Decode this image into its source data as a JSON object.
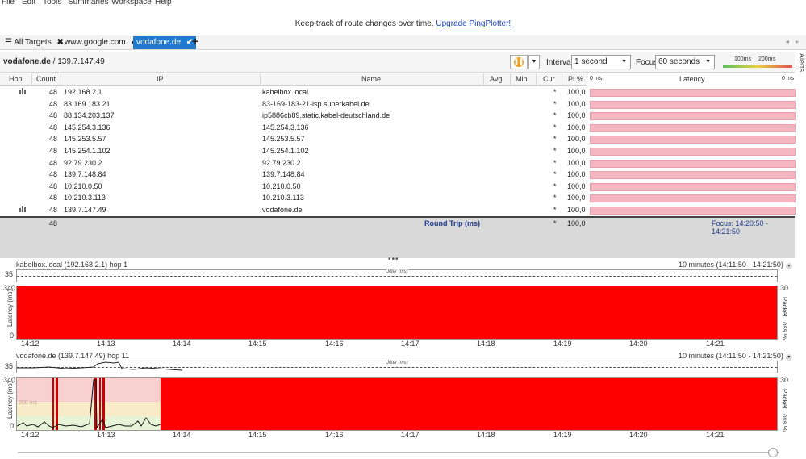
{
  "menu": [
    "File",
    "Edit",
    "Tools",
    "Summaries",
    "Workspace",
    "Help"
  ],
  "banner": {
    "text": "Keep track of route changes over time.",
    "link": "Upgrade PingPlotter!"
  },
  "tabs": [
    {
      "label": "All Targets",
      "marker": "✖"
    },
    {
      "label": "www.google.com",
      "marker": "✔"
    },
    {
      "label": "vodafone.de",
      "marker": "✔"
    }
  ],
  "tab_add": "+",
  "alerts_label": "Alerts",
  "toolbar": {
    "target_name": "vodafone.de",
    "target_ip": " / 139.7.147.49",
    "interval_label": "Interval",
    "interval_value": "1 second",
    "focus_label": "Focus",
    "focus_value": "60 seconds",
    "scale_low": "100ms",
    "scale_high": "200ms"
  },
  "table": {
    "columns": [
      "Hop",
      "Count",
      "IP",
      "Name",
      "Avg",
      "Min",
      "Cur",
      "PL%",
      "Latency"
    ],
    "latency_min": "0 ms",
    "latency_max": "0 ms",
    "rows": [
      {
        "hop_icon": true,
        "count": "48",
        "ip": "192.168.2.1",
        "name": "kabelbox.local",
        "avg": "",
        "min": "",
        "cur": "*",
        "pl": "100,0"
      },
      {
        "hop_icon": false,
        "count": "48",
        "ip": "83.169.183.21",
        "name": "83-169-183-21-isp.superkabel.de",
        "avg": "",
        "min": "",
        "cur": "*",
        "pl": "100,0"
      },
      {
        "hop_icon": false,
        "count": "48",
        "ip": "88.134.203.137",
        "name": "ip5886cb89.static.kabel-deutschland.de",
        "avg": "",
        "min": "",
        "cur": "*",
        "pl": "100,0"
      },
      {
        "hop_icon": false,
        "count": "48",
        "ip": "145.254.3.136",
        "name": "145.254.3.136",
        "avg": "",
        "min": "",
        "cur": "*",
        "pl": "100,0"
      },
      {
        "hop_icon": false,
        "count": "48",
        "ip": "145.253.5.57",
        "name": "145.253.5.57",
        "avg": "",
        "min": "",
        "cur": "*",
        "pl": "100,0"
      },
      {
        "hop_icon": false,
        "count": "48",
        "ip": "145.254.1.102",
        "name": "145.254.1.102",
        "avg": "",
        "min": "",
        "cur": "*",
        "pl": "100,0"
      },
      {
        "hop_icon": false,
        "count": "48",
        "ip": "92.79.230.2",
        "name": "92.79.230.2",
        "avg": "",
        "min": "",
        "cur": "*",
        "pl": "100,0"
      },
      {
        "hop_icon": false,
        "count": "48",
        "ip": "139.7.148.84",
        "name": "139.7.148.84",
        "avg": "",
        "min": "",
        "cur": "*",
        "pl": "100,0"
      },
      {
        "hop_icon": false,
        "count": "48",
        "ip": "10.210.0.50",
        "name": "10.210.0.50",
        "avg": "",
        "min": "",
        "cur": "*",
        "pl": "100,0"
      },
      {
        "hop_icon": false,
        "count": "48",
        "ip": "10.210.3.113",
        "name": "10.210.3.113",
        "avg": "",
        "min": "",
        "cur": "*",
        "pl": "100,0"
      },
      {
        "hop_icon": true,
        "count": "48",
        "ip": "139.7.147.49",
        "name": "vodafone.de",
        "avg": "",
        "min": "",
        "cur": "*",
        "pl": "100,0"
      }
    ],
    "summary": {
      "count": "48",
      "label": "Round Trip (ms)",
      "cur": "*",
      "pl": "100,0",
      "focus": "Focus: 14:20:50 - 14:21:50"
    }
  },
  "splitter_glyph": "•••",
  "graphs": [
    {
      "title": "kabelbox.local (192.168.2.1) hop 1",
      "range": "10 minutes (14:11:50 - 14:21:50)",
      "jitter_label": "Jitter (ms)",
      "jitter_max": "35",
      "latency_max": "340",
      "latency_min": "0",
      "y_label": "Latency (ms)",
      "y2_label": "Packet Loss %",
      "y2_max": "30",
      "times": [
        "14:12",
        "14:13",
        "14:14",
        "14:15",
        "14:16",
        "14:17",
        "14:18",
        "14:19",
        "14:20",
        "14:21"
      ]
    },
    {
      "title": "vodafone.de (139.7.147.49) hop 11",
      "range": "10 minutes (14:11:50 - 14:21:50)",
      "jitter_label": "Jitter (ms)",
      "jitter_max": "35",
      "latency_max": "340",
      "latency_min": "0",
      "mid_label": "200 ms",
      "y_label": "Latency (ms)",
      "y2_label": "Packet Loss %",
      "y2_max": "30",
      "times": [
        "14:12",
        "14:13",
        "14:14",
        "14:15",
        "14:16",
        "14:17",
        "14:18",
        "14:19",
        "14:20",
        "14:21"
      ]
    }
  ],
  "colors": {
    "loss_red": "#ff0000",
    "latency_bar_pink": "#f4b6c0",
    "tab_active": "#1f7bd1",
    "link_blue": "#1a3fb0",
    "summary_blue": "#1f3a8a"
  }
}
